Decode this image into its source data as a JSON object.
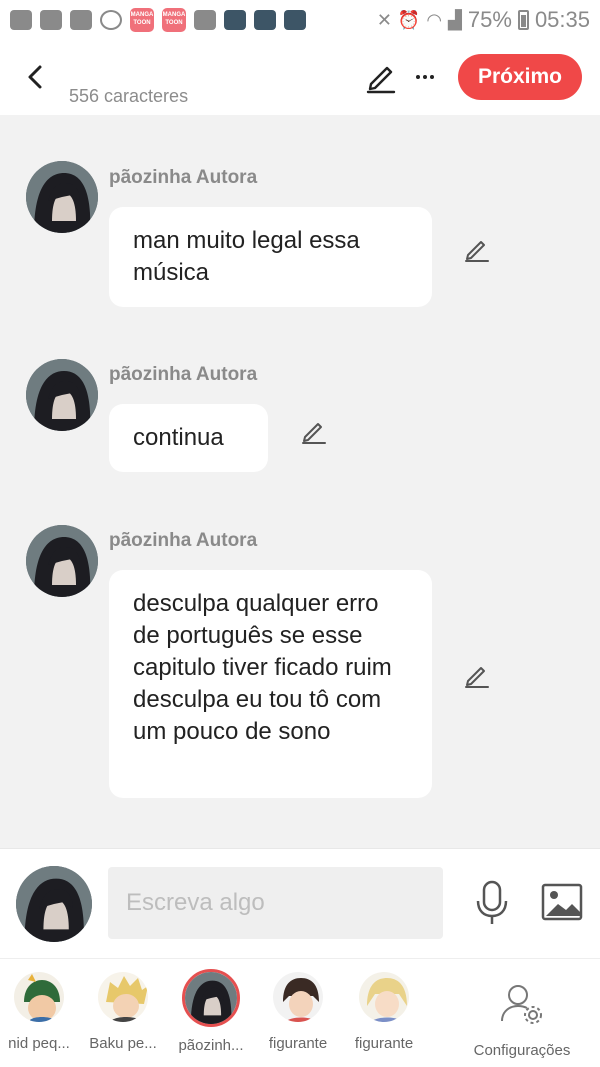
{
  "status_bar": {
    "battery": "75%",
    "time": "05:35",
    "manga_label": "MANGA TOON"
  },
  "header": {
    "char_count": "556 caracteres",
    "next_label": "Próximo"
  },
  "messages": [
    {
      "author": "pãozinha Autora",
      "text": "man muito legal essa música"
    },
    {
      "author": "pãozinha Autora",
      "text": "continua"
    },
    {
      "author": "pãozinha Autora",
      "text": "desculpa qualquer erro de português se esse capitulo tiver ficado ruim desculpa eu tou tô com um pouco de sono"
    }
  ],
  "composer": {
    "placeholder": "Escreva algo"
  },
  "characters": [
    {
      "name": "nid peq..."
    },
    {
      "name": "Baku pe..."
    },
    {
      "name": "pãozinh..."
    },
    {
      "name": "figurante"
    },
    {
      "name": "figurante"
    }
  ],
  "settings_label": "Configurações",
  "colors": {
    "accent": "#f04848",
    "background": "#f2f2f2",
    "bubble": "#ffffff"
  }
}
